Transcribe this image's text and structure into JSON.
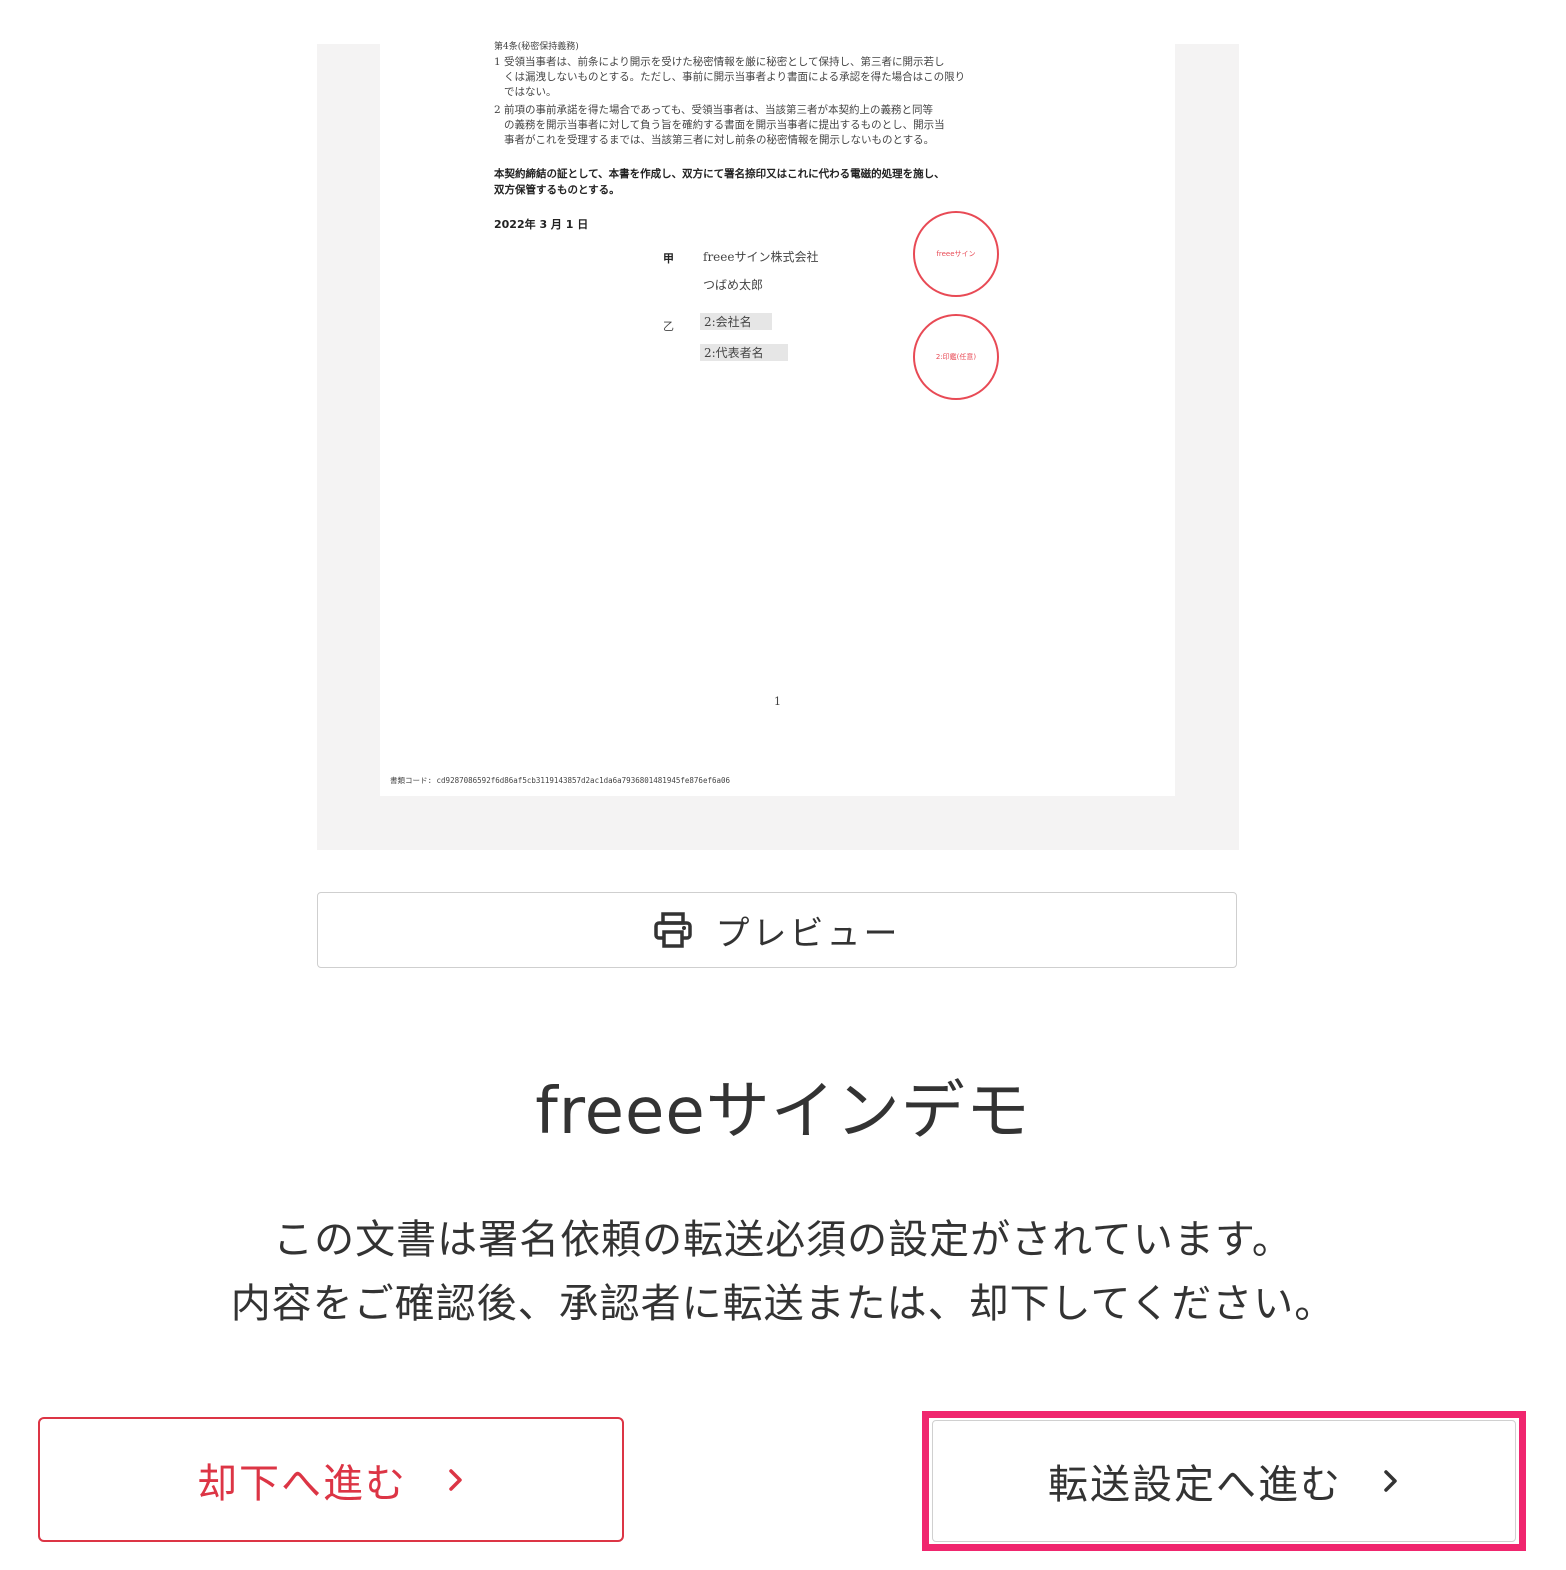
{
  "document": {
    "clause_heading": "第4条(秘密保持義務)",
    "clause_1_line_1": "1 受領当事者は、前条により開示を受けた秘密情報を厳に秘密として保持し、第三者に開示若し",
    "clause_1_line_2": "くは漏洩しないものとする。ただし、事前に開示当事者より書面による承認を得た場合はこの限り",
    "clause_1_line_3": "ではない。",
    "clause_2_line_1": "2 前項の事前承諾を得た場合であっても、受領当事者は、当該第三者が本契約上の義務と同等",
    "clause_2_line_2": "の義務を開示当事者に対して負う旨を確約する書面を開示当事者に提出するものとし、開示当",
    "clause_2_line_3": "事者がこれを受理するまでは、当該第三者に対し前条の秘密情報を開示しないものとする。",
    "closing_line_1": "本契約締結の証として、本書を作成し、双方にて署名捺印又はこれに代わる電磁的処理を施し、",
    "closing_line_2": "双方保管するものとする。",
    "date": "2022年 3 月 1 日",
    "party_a_label": "甲",
    "party_a_company": "freeeサイン株式会社",
    "party_a_person": "つばめ太郎",
    "party_a_stamp": "freeeサイン",
    "party_b_label": "乙",
    "party_b_company": "2:会社名",
    "party_b_person": "2:代表者名",
    "party_b_stamp": "2:印鑑(任意)",
    "page_number": "1",
    "document_code": "書類コード: cd9287086592f6d86af5cb3119143857d2ac1da6a7936801481945fe876ef6a06"
  },
  "preview_button": {
    "label": "プレビュー",
    "icon": "printer-icon"
  },
  "app_title": "freeeサインデモ",
  "message": {
    "line_1": "この文書は署名依頼の転送必須の設定がされています。",
    "line_2": "内容をご確認後、承認者に転送または、却下してください。"
  },
  "actions": {
    "reject_label": "却下へ進む",
    "forward_label": "転送設定へ進む"
  },
  "colors": {
    "reject": "#dc3545",
    "highlight": "#f0266e",
    "stamp": "#e84a55",
    "text": "#333333"
  }
}
